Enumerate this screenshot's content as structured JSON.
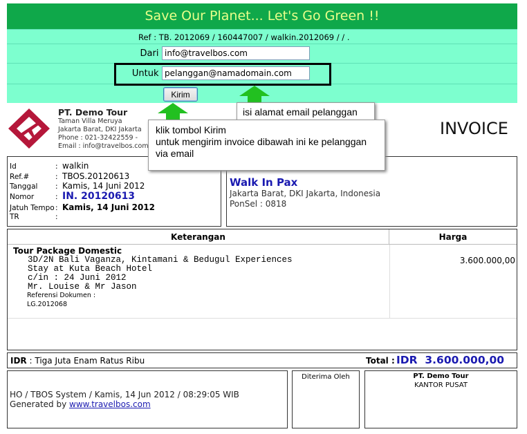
{
  "form": {
    "banner": "Save Our Planet... Let's Go Green !!",
    "ref_label": "Ref :",
    "ref_value": "TB. 2012069 / 160447007 / walkin.2012069 / / .",
    "dari_label": "Dari :",
    "dari_value": "info@travelbos.com",
    "untuk_label": "Untuk :",
    "untuk_value": "pelanggan@namadomain.com",
    "kirim_button": "Kirim"
  },
  "callouts": {
    "email_hint": "isi alamat email pelanggan",
    "kirim_hint_1": "klik tombol Kirim",
    "kirim_hint_2": "untuk mengirim invoice dibawah ini ke pelanggan",
    "kirim_hint_3": "via email",
    "arrow_color": "#22c020"
  },
  "company": {
    "name": "PT. Demo Tour",
    "address1": "Taman Villa Meruya",
    "address2": "Jakarta Barat, DKI Jakarta",
    "phone": "Phone : 021-32422559 -",
    "email": "Email : info@travelbos.com",
    "logo_color": "#b5173a"
  },
  "invoice_title": "INVOICE",
  "customer": {
    "fields": [
      {
        "key": "Id",
        "value": "walkin"
      },
      {
        "key": "Ref.#",
        "value": "TBOS.20120613"
      },
      {
        "key": "Tanggal",
        "value": "Kamis, 14 Juni 2012"
      },
      {
        "key": "Nomor",
        "value": "IN. 20120613"
      },
      {
        "key": "Jatuh Tempo",
        "value": "Kamis, 14 Juni 2012"
      },
      {
        "key": "TR",
        "value": ""
      }
    ],
    "name": "Walk In Pax",
    "address": "Jakarta Barat, DKI Jakarta, Indonesia",
    "ponsel": "PonSel : 0818"
  },
  "items": {
    "header_keterangan": "Keterangan",
    "header_harga": "Harga",
    "package_title": "Tour Package Domestic",
    "lines": [
      "3D/2N Bali Vaganza, Kintamani & Bedugul Experiences",
      "Stay at Kuta Beach Hotel",
      "c/in : 24 Juni 2012",
      "Mr. Louise & Mr Jason"
    ],
    "referensi_label": "Referensi Dokumen :",
    "referensi_value": "LG.2012068",
    "price": "3.600.000,00"
  },
  "total": {
    "idr_label": "IDR",
    "terbilang": ": Tiga Juta Enam Ratus Ribu",
    "total_label": "Total :",
    "total_value": "IDR  3.600.000,00"
  },
  "footer": {
    "system_line": "HO / TBOS System / Kamis, 14 Jun 2012 / 08:29:05 WIB",
    "generated_by": "Generated by",
    "link": "www.travelbos.com",
    "diterima_oleh": "Diterima Oleh",
    "company": "PT. Demo Tour",
    "office": "KANTOR PUSAT"
  }
}
